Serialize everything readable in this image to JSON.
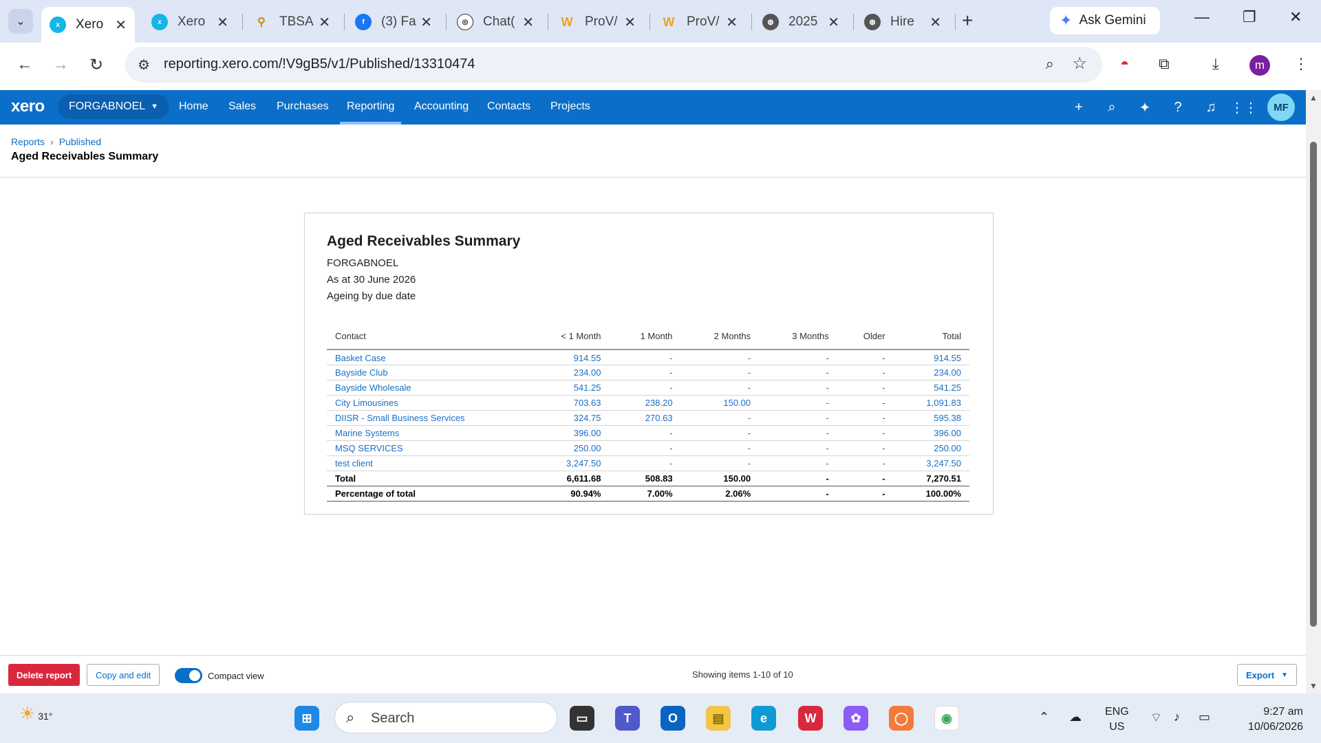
{
  "browser": {
    "tabs": [
      {
        "title": "Xero",
        "active": true
      },
      {
        "title": "Xero"
      },
      {
        "title": "TBSA"
      },
      {
        "title": "(3) Fa"
      },
      {
        "title": "Chat("
      },
      {
        "title": "ProV/"
      },
      {
        "title": "ProV/"
      },
      {
        "title": "2025"
      },
      {
        "title": "Hire"
      }
    ],
    "gemini_label": "Ask Gemini",
    "url": "reporting.xero.com/!V9gB5/v1/Published/13310474",
    "profile_initial": "m"
  },
  "xero_nav": {
    "logo": "xero",
    "org": "FORGABNOEL",
    "links": [
      "Home",
      "Sales",
      "Purchases",
      "Reporting",
      "Accounting",
      "Contacts",
      "Projects"
    ],
    "active_link": "Reporting",
    "avatar": "MF"
  },
  "breadcrumb": {
    "reports": "Reports",
    "published": "Published"
  },
  "page_title": "Aged Receivables Summary",
  "report": {
    "title": "Aged Receivables Summary",
    "org": "FORGABNOEL",
    "as_at": "As at 30 June 2026",
    "ageing": "Ageing by due date",
    "columns": [
      "Contact",
      "< 1 Month",
      "1 Month",
      "2 Months",
      "3 Months",
      "Older",
      "Total"
    ],
    "rows": [
      [
        "Basket Case",
        "914.55",
        "-",
        "-",
        "-",
        "-",
        "914.55"
      ],
      [
        "Bayside Club",
        "234.00",
        "-",
        "-",
        "-",
        "-",
        "234.00"
      ],
      [
        "Bayside Wholesale",
        "541.25",
        "-",
        "-",
        "-",
        "-",
        "541.25"
      ],
      [
        "City Limousines",
        "703.63",
        "238.20",
        "150.00",
        "-",
        "-",
        "1,091.83"
      ],
      [
        "DIISR - Small Business Services",
        "324.75",
        "270.63",
        "-",
        "-",
        "-",
        "595.38"
      ],
      [
        "Marine Systems",
        "396.00",
        "-",
        "-",
        "-",
        "-",
        "396.00"
      ],
      [
        "MSQ SERVICES",
        "250.00",
        "-",
        "-",
        "-",
        "-",
        "250.00"
      ],
      [
        "test client",
        "3,247.50",
        "-",
        "-",
        "-",
        "-",
        "3,247.50"
      ]
    ],
    "total": [
      "Total",
      "6,611.68",
      "508.83",
      "150.00",
      "-",
      "-",
      "7,270.51"
    ],
    "percentage": [
      "Percentage of total",
      "90.94%",
      "7.00%",
      "2.06%",
      "-",
      "-",
      "100.00%"
    ]
  },
  "footer": {
    "delete": "Delete report",
    "copy": "Copy and edit",
    "compact": "Compact view",
    "showing": "Showing items 1-10 of 10",
    "export": "Export"
  },
  "taskbar": {
    "temp": "31°",
    "search": "Search",
    "lang1": "ENG",
    "lang2": "US",
    "time": "9:27 am",
    "date": "10/06/2026"
  }
}
